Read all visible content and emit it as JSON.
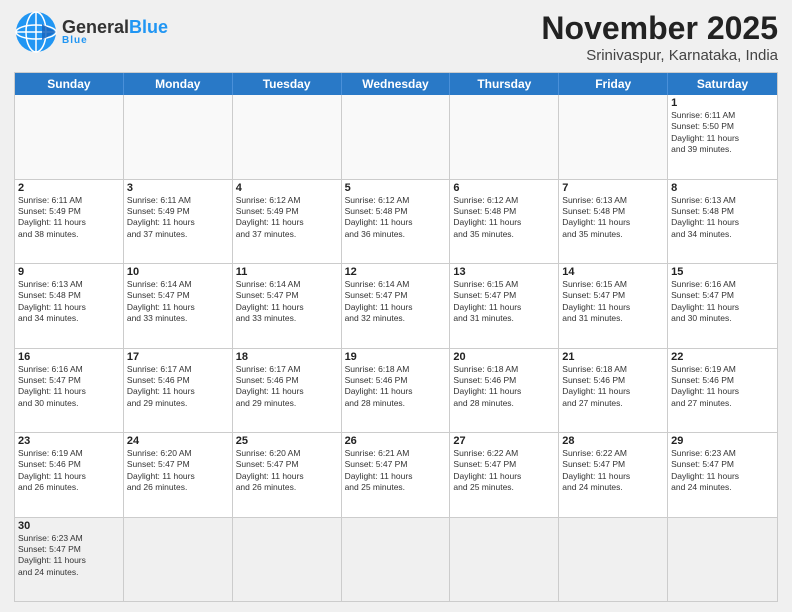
{
  "header": {
    "logo_top": "General",
    "logo_blue": "Blue",
    "title": "November 2025",
    "subtitle": "Srinivaspur, Karnataka, India"
  },
  "days_of_week": [
    "Sunday",
    "Monday",
    "Tuesday",
    "Wednesday",
    "Thursday",
    "Friday",
    "Saturday"
  ],
  "weeks": [
    [
      {
        "date": "",
        "info": ""
      },
      {
        "date": "",
        "info": ""
      },
      {
        "date": "",
        "info": ""
      },
      {
        "date": "",
        "info": ""
      },
      {
        "date": "",
        "info": ""
      },
      {
        "date": "",
        "info": ""
      },
      {
        "date": "1",
        "info": "Sunrise: 6:11 AM\nSunset: 5:50 PM\nDaylight: 11 hours\nand 39 minutes."
      }
    ],
    [
      {
        "date": "2",
        "info": "Sunrise: 6:11 AM\nSunset: 5:49 PM\nDaylight: 11 hours\nand 38 minutes."
      },
      {
        "date": "3",
        "info": "Sunrise: 6:11 AM\nSunset: 5:49 PM\nDaylight: 11 hours\nand 37 minutes."
      },
      {
        "date": "4",
        "info": "Sunrise: 6:12 AM\nSunset: 5:49 PM\nDaylight: 11 hours\nand 37 minutes."
      },
      {
        "date": "5",
        "info": "Sunrise: 6:12 AM\nSunset: 5:48 PM\nDaylight: 11 hours\nand 36 minutes."
      },
      {
        "date": "6",
        "info": "Sunrise: 6:12 AM\nSunset: 5:48 PM\nDaylight: 11 hours\nand 35 minutes."
      },
      {
        "date": "7",
        "info": "Sunrise: 6:13 AM\nSunset: 5:48 PM\nDaylight: 11 hours\nand 35 minutes."
      },
      {
        "date": "8",
        "info": "Sunrise: 6:13 AM\nSunset: 5:48 PM\nDaylight: 11 hours\nand 34 minutes."
      }
    ],
    [
      {
        "date": "9",
        "info": "Sunrise: 6:13 AM\nSunset: 5:48 PM\nDaylight: 11 hours\nand 34 minutes."
      },
      {
        "date": "10",
        "info": "Sunrise: 6:14 AM\nSunset: 5:47 PM\nDaylight: 11 hours\nand 33 minutes."
      },
      {
        "date": "11",
        "info": "Sunrise: 6:14 AM\nSunset: 5:47 PM\nDaylight: 11 hours\nand 33 minutes."
      },
      {
        "date": "12",
        "info": "Sunrise: 6:14 AM\nSunset: 5:47 PM\nDaylight: 11 hours\nand 32 minutes."
      },
      {
        "date": "13",
        "info": "Sunrise: 6:15 AM\nSunset: 5:47 PM\nDaylight: 11 hours\nand 31 minutes."
      },
      {
        "date": "14",
        "info": "Sunrise: 6:15 AM\nSunset: 5:47 PM\nDaylight: 11 hours\nand 31 minutes."
      },
      {
        "date": "15",
        "info": "Sunrise: 6:16 AM\nSunset: 5:47 PM\nDaylight: 11 hours\nand 30 minutes."
      }
    ],
    [
      {
        "date": "16",
        "info": "Sunrise: 6:16 AM\nSunset: 5:47 PM\nDaylight: 11 hours\nand 30 minutes."
      },
      {
        "date": "17",
        "info": "Sunrise: 6:17 AM\nSunset: 5:46 PM\nDaylight: 11 hours\nand 29 minutes."
      },
      {
        "date": "18",
        "info": "Sunrise: 6:17 AM\nSunset: 5:46 PM\nDaylight: 11 hours\nand 29 minutes."
      },
      {
        "date": "19",
        "info": "Sunrise: 6:18 AM\nSunset: 5:46 PM\nDaylight: 11 hours\nand 28 minutes."
      },
      {
        "date": "20",
        "info": "Sunrise: 6:18 AM\nSunset: 5:46 PM\nDaylight: 11 hours\nand 28 minutes."
      },
      {
        "date": "21",
        "info": "Sunrise: 6:18 AM\nSunset: 5:46 PM\nDaylight: 11 hours\nand 27 minutes."
      },
      {
        "date": "22",
        "info": "Sunrise: 6:19 AM\nSunset: 5:46 PM\nDaylight: 11 hours\nand 27 minutes."
      }
    ],
    [
      {
        "date": "23",
        "info": "Sunrise: 6:19 AM\nSunset: 5:46 PM\nDaylight: 11 hours\nand 26 minutes."
      },
      {
        "date": "24",
        "info": "Sunrise: 6:20 AM\nSunset: 5:47 PM\nDaylight: 11 hours\nand 26 minutes."
      },
      {
        "date": "25",
        "info": "Sunrise: 6:20 AM\nSunset: 5:47 PM\nDaylight: 11 hours\nand 26 minutes."
      },
      {
        "date": "26",
        "info": "Sunrise: 6:21 AM\nSunset: 5:47 PM\nDaylight: 11 hours\nand 25 minutes."
      },
      {
        "date": "27",
        "info": "Sunrise: 6:22 AM\nSunset: 5:47 PM\nDaylight: 11 hours\nand 25 minutes."
      },
      {
        "date": "28",
        "info": "Sunrise: 6:22 AM\nSunset: 5:47 PM\nDaylight: 11 hours\nand 24 minutes."
      },
      {
        "date": "29",
        "info": "Sunrise: 6:23 AM\nSunset: 5:47 PM\nDaylight: 11 hours\nand 24 minutes."
      }
    ],
    [
      {
        "date": "30",
        "info": "Sunrise: 6:23 AM\nSunset: 5:47 PM\nDaylight: 11 hours\nand 24 minutes."
      },
      {
        "date": "",
        "info": ""
      },
      {
        "date": "",
        "info": ""
      },
      {
        "date": "",
        "info": ""
      },
      {
        "date": "",
        "info": ""
      },
      {
        "date": "",
        "info": ""
      },
      {
        "date": "",
        "info": ""
      }
    ]
  ]
}
